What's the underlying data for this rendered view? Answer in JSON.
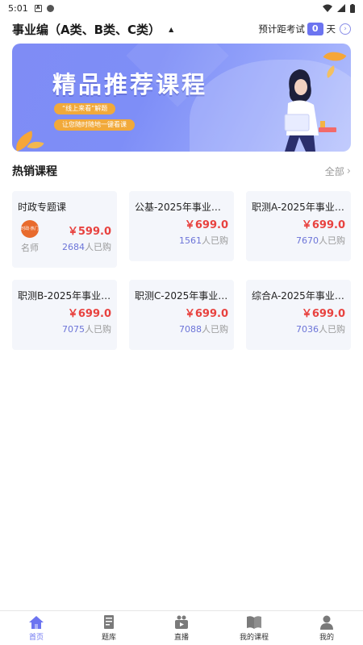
{
  "status_bar": {
    "time": "5:01"
  },
  "header": {
    "exam_title": "事业编（A类、B类、C类）",
    "countdown_label": "预计距考试",
    "countdown_days": "0",
    "countdown_unit": "天"
  },
  "banner": {
    "headline": "精品推荐课程",
    "tag1": "“线上来看”解题",
    "tag2": "让您随时随地一键看课"
  },
  "section": {
    "title": "热销课程",
    "see_all": "全部"
  },
  "courses": [
    {
      "title": "时政专题课",
      "price": "￥599.0",
      "bought_count": "2684",
      "bought_suffix": "人已购",
      "teacher": "名师",
      "avatar_text": "时政·热门"
    },
    {
      "title": "公基-2025年事业单…",
      "price": "￥699.0",
      "bought_count": "1561",
      "bought_suffix": "人已购"
    },
    {
      "title": "职测A-2025年事业…",
      "price": "￥699.0",
      "bought_count": "7670",
      "bought_suffix": "人已购"
    },
    {
      "title": "职测B-2025年事业…",
      "price": "￥699.0",
      "bought_count": "7075",
      "bought_suffix": "人已购"
    },
    {
      "title": "职测C-2025年事业…",
      "price": "￥699.0",
      "bought_count": "7088",
      "bought_suffix": "人已购"
    },
    {
      "title": "综合A-2025年事业…",
      "price": "￥699.0",
      "bought_count": "7036",
      "bought_suffix": "人已购"
    }
  ],
  "bottom_nav": [
    {
      "label": "首页",
      "icon": "home-icon",
      "active": true
    },
    {
      "label": "题库",
      "icon": "question-bank-icon"
    },
    {
      "label": "直播",
      "icon": "live-icon"
    },
    {
      "label": "我的课程",
      "icon": "my-courses-icon"
    },
    {
      "label": "我的",
      "icon": "profile-icon"
    }
  ],
  "colors": {
    "accent": "#6c74f0",
    "price": "#e8423f",
    "card_bg": "#f4f6fb"
  }
}
